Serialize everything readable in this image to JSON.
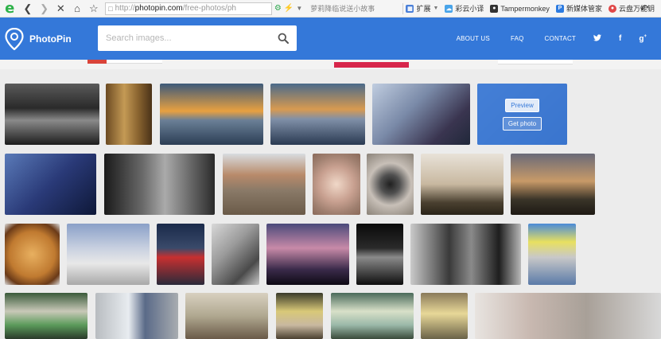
{
  "browser": {
    "url_protocol": "http://",
    "url_host": "photopin.com",
    "url_path": "/free-photos/ph",
    "search_placeholder": "萝莉降临说送小故事",
    "bookmarks": [
      {
        "label": "扩展",
        "icon": "extensions-icon",
        "color": "#4a7fd8"
      },
      {
        "label": "彩云小译",
        "icon": "translate-icon",
        "color": "#49a4e9"
      },
      {
        "label": "Tampermonkey",
        "icon": "tampermonkey-icon",
        "color": "#333333"
      },
      {
        "label": "新媒体管家",
        "icon": "media-manager-icon",
        "color": "#2d7be0"
      },
      {
        "label": "云盘万能钥",
        "icon": "key-icon",
        "color": "#e04848"
      }
    ]
  },
  "site": {
    "brand": "PhotoPin",
    "search_placeholder": "Search images...",
    "nav": [
      {
        "label": "ABOUT US",
        "name": "nav-about-us"
      },
      {
        "label": "FAQ",
        "name": "nav-faq"
      },
      {
        "label": "CONTACT",
        "name": "nav-contact"
      }
    ],
    "social": [
      "twitter-icon",
      "facebook-icon",
      "google-plus-icon"
    ],
    "accent": "#3478d9"
  },
  "gallery": {
    "overlay": {
      "preview_label": "Preview",
      "get_label": "Get photo"
    },
    "photos": [
      {
        "name": "photo-storefront-bw",
        "bg": "linear-gradient(180deg,#5a5a5a 0%,#2a2a2a 40%,#8a8a8a 60%,#1d1d1d 100%)"
      },
      {
        "name": "photo-antique-telephone",
        "bg": "linear-gradient(90deg,#6b4a22 0%,#c49a55 40%,#8a6430 70%,#4a3218 100%)"
      },
      {
        "name": "photo-sunset-beach",
        "bg": "linear-gradient(180deg,#3d5a7a 0%,#e8a040 45%,#6a7f96 60%,#2c3e55 100%)"
      },
      {
        "name": "photo-sunset-silhouette",
        "bg": "linear-gradient(180deg,#4a6a8a 0%,#d89a50 42%,#8090a8 58%,#2a3a52 100%)"
      },
      {
        "name": "photo-phone-camera-beach",
        "bg": "linear-gradient(135deg,#c0cde0 0%,#7a8aa8 40%,#3a3550 75%,#20283a 100%)"
      },
      {
        "name": "photo-woman-hover",
        "bg": "linear-gradient(135deg,#8aa0c8 0%,#546a99 100%)",
        "hover": true
      },
      {
        "name": "photo-phone-screen-night",
        "bg": "linear-gradient(135deg,#5a7ab8 0%,#2a3a78 50%,#0e1838 100%)"
      },
      {
        "name": "photo-cafe-bw",
        "bg": "linear-gradient(90deg,#1a1a1a 0%,#6a6a6a 35%,#aaaaaa 55%,#2a2a2a 100%)"
      },
      {
        "name": "photo-railway-buildings",
        "bg": "linear-gradient(180deg,#d8dce0 0%,#b88a6a 35%,#8a7a68 60%,#6a5a48 100%)"
      },
      {
        "name": "photo-circular-blade",
        "bg": "radial-gradient(circle,#f0d8c8 0%,#c8a090 45%,#a08070 75%,#8a6a5a 100%)"
      },
      {
        "name": "photo-metal-gear",
        "bg": "radial-gradient(circle,#202020 0%,#505050 25%,#c8c0b8 55%,#8a8278 100%)"
      },
      {
        "name": "photo-tree-clouds",
        "bg": "linear-gradient(180deg,#e8e2d8 0%,#c8b8a0 50%,#4a4030 80%,#2a2418 100%)"
      },
      {
        "name": "photo-tree-sunset",
        "bg": "linear-gradient(180deg,#6a6a78 0%,#c89a68 45%,#3a3428 75%,#1e1a14 100%)"
      },
      {
        "name": "photo-bread-loaf",
        "bg": "radial-gradient(circle,#e8b060 0%,#c07a30 55%,#6a3a18 80%,#dcdcdc 100%)"
      },
      {
        "name": "photo-modern-building",
        "bg": "linear-gradient(180deg,#8aa0c8 0%,#c8d0e0 40%,#e8e8e8 65%,#a8a8a8 100%)"
      },
      {
        "name": "photo-stop-sign",
        "bg": "linear-gradient(180deg,#1a2a4a 0%,#3a4a6a 40%,#c83030 55%,#2a2a3a 100%)"
      },
      {
        "name": "photo-street-blur",
        "bg": "linear-gradient(135deg,#d8d8d8 0%,#9a9a9a 40%,#4a4a4a 75%,#c8c8c8 100%)"
      },
      {
        "name": "photo-purple-dusk",
        "bg": "linear-gradient(180deg,#4a4a7a 0%,#c88aa8 40%,#3a2a4a 75%,#0e0a14 100%)"
      },
      {
        "name": "photo-dark-window",
        "bg": "linear-gradient(180deg,#0a0a0a 0%,#2a2a2a 40%,#8a8a8a 55%,#0e0e0e 100%)"
      },
      {
        "name": "photo-couple-bw",
        "bg": "linear-gradient(90deg,#cacaca 0%,#3a3a3a 35%,#8a8a8a 55%,#1e1e1e 80%,#b8b8b8 100%)"
      },
      {
        "name": "photo-ticket-machine",
        "bg": "linear-gradient(180deg,#4a8ad8 0%,#e8e060 30%,#c8c8c8 55%,#5a7aa8 100%)"
      },
      {
        "name": "photo-gtl-phone-1",
        "bg": "linear-gradient(180deg,#3a5a3a 0%,#c8c8b8 40%,#5a9a5a 70%,#2a3a2a 100%)"
      },
      {
        "name": "photo-payphone-silver",
        "bg": "linear-gradient(90deg,#b8bcc0 0%,#e8ecf0 40%,#5a6a88 60%,#a8acb0 100%)"
      },
      {
        "name": "photo-corridor",
        "bg": "linear-gradient(180deg,#d8d0c0 0%,#b0a890 50%,#6a5a48 100%)"
      },
      {
        "name": "photo-gtl-phone-2",
        "bg": "linear-gradient(180deg,#3a3a2a 0%,#d8c878 40%,#c8b8a0 70%,#4a4030 100%)"
      },
      {
        "name": "photo-gtl-phone-3",
        "bg": "linear-gradient(180deg,#4a6a5a 0%,#d8e0c8 40%,#9ab8a8 70%,#3a4a3a 100%)"
      },
      {
        "name": "photo-payphone-yellow",
        "bg": "linear-gradient(180deg,#8a7a5a 0%,#e8d898 45%,#6a6248 100%)"
      },
      {
        "name": "photo-blurred-edge",
        "bg": "linear-gradient(90deg,#e8e4e0 0%,#c8b8b0 30%,#a8a098 60%,#d8d8d8 100%)"
      }
    ]
  }
}
